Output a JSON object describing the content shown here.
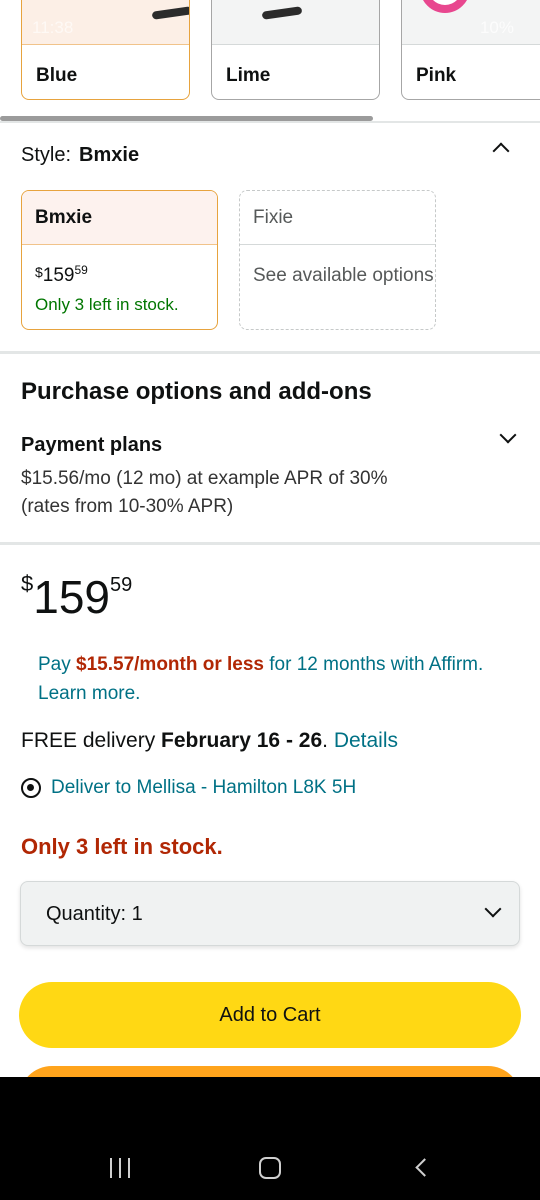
{
  "status_bar": {
    "time": "11:38",
    "battery": "10%"
  },
  "colors": {
    "selected_border": "#e7a33e",
    "link": "#007185",
    "price_red": "#b12704",
    "stock_green": "#007600",
    "add_to_cart": "#ffd814",
    "buy_now": "#ffa41c"
  },
  "color_options": [
    {
      "label": "Blue",
      "selected": true
    },
    {
      "label": "Lime",
      "selected": false
    },
    {
      "label": "Pink",
      "selected": false
    }
  ],
  "style": {
    "label": "Style:",
    "selected_value": "Bmxie",
    "options": [
      {
        "name": "Bmxie",
        "price_currency": "$",
        "price_whole": "159",
        "price_fraction": "59",
        "stock": "Only 3 left in stock.",
        "selected": true
      },
      {
        "name": "Fixie",
        "availability": "See available options",
        "selected": false
      }
    ]
  },
  "purchase_options": {
    "title": "Purchase options and add-ons",
    "payment_plans": {
      "title": "Payment plans",
      "description": "$15.56/mo (12 mo) at example APR of 30% (rates from 10-30% APR)"
    }
  },
  "price": {
    "currency": "$",
    "whole": "159",
    "fraction": "59"
  },
  "affirm": {
    "prefix": "Pay",
    "amount": "$15.57/month or less",
    "suffix": "for 12 months with Affirm.",
    "link": "Learn more."
  },
  "delivery": {
    "prefix": "FREE delivery",
    "dates": "February 16 - 26",
    "link": "Details",
    "deliver_to": "Deliver to Mellisa - Hamilton L8K 5H"
  },
  "stock_message": "Only 3 left in stock.",
  "quantity": {
    "label": "Quantity:",
    "value": "1"
  },
  "buttons": {
    "add_to_cart": "Add to Cart"
  },
  "icons": {
    "collapse": "chevron-up-icon",
    "expand": "chevron-down-icon",
    "location": "location-pin-icon",
    "nav_recent": "recent-apps-icon",
    "nav_home": "home-icon",
    "nav_back": "back-icon"
  }
}
